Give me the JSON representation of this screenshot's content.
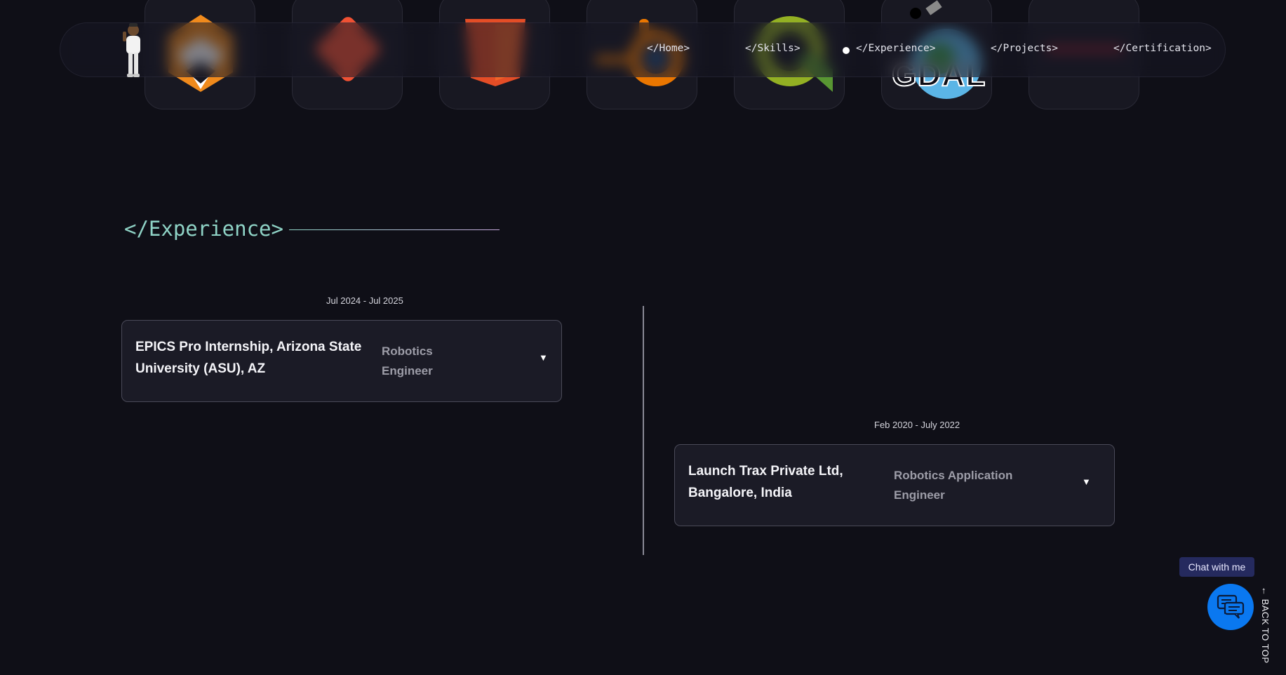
{
  "nav": {
    "items": [
      {
        "label": "</Home>"
      },
      {
        "label": "</Skills>"
      },
      {
        "label": "</Experience>"
      },
      {
        "label": "</Projects>"
      },
      {
        "label": "</Certification>"
      }
    ],
    "active_item": "</Experience>"
  },
  "skills_row": {
    "icons": [
      "unity-icon",
      "git-icon",
      "html5-icon",
      "blender-icon",
      "qgis-icon",
      "gdal-icon",
      "unknown-tool-icon"
    ],
    "gdal_label": "GDAL"
  },
  "section": {
    "title": "</Experience>"
  },
  "experience": [
    {
      "date": "Jul 2024 - Jul 2025",
      "company": "EPICS Pro Internship, Arizona State University (ASU), AZ",
      "role": "Robotics Engineer",
      "caret": "▼"
    },
    {
      "date": "Feb 2020 - July 2022",
      "company": "Launch Trax Private Ltd,\n Bangalore, India",
      "role": "Robotics Application Engineer",
      "caret": "▼"
    }
  ],
  "chat": {
    "tooltip": "Chat with me",
    "icon": "chat-bubbles-icon"
  },
  "back_to_top": "← BACK TO TOP",
  "colors": {
    "background": "#0f0f17",
    "accent_teal": "#8fd3c6",
    "chat_blue": "#0a78f0",
    "card_bg": "#1b1b26"
  }
}
